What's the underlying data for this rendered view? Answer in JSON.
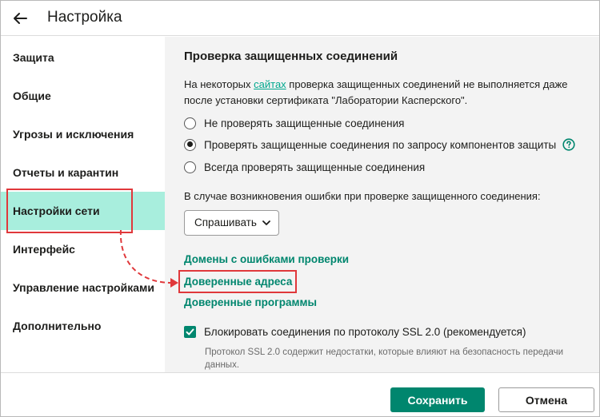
{
  "header": {
    "title": "Настройка"
  },
  "sidebar": {
    "items": [
      {
        "label": "Защита"
      },
      {
        "label": "Общие"
      },
      {
        "label": "Угрозы и исключения"
      },
      {
        "label": "Отчеты и карантин"
      },
      {
        "label": "Настройки сети"
      },
      {
        "label": "Интерфейс"
      },
      {
        "label": "Управление настройками"
      },
      {
        "label": "Дополнительно"
      }
    ],
    "active_index": 4
  },
  "main": {
    "section_title": "Проверка защищенных соединений",
    "desc_before": "На некоторых ",
    "desc_link": "сайтах",
    "desc_after": " проверка защищенных соединений не выполняется даже после установки сертификата \"Лаборатории Касперского\".",
    "radios": [
      {
        "label": "Не проверять защищенные соединения",
        "checked": false
      },
      {
        "label": "Проверять защищенные соединения по запросу компонентов защиты",
        "checked": true
      },
      {
        "label": "Всегда проверять защищенные соединения",
        "checked": false
      }
    ],
    "error_label": "В случае возникновения ошибки при проверке защищенного соединения:",
    "error_dropdown_value": "Спрашивать",
    "links": [
      {
        "label": "Домены с ошибками проверки"
      },
      {
        "label": "Доверенные адреса"
      },
      {
        "label": "Доверенные программы"
      }
    ],
    "ssl_checkbox_label": "Блокировать соединения по протоколу SSL 2.0 (рекомендуется)",
    "ssl_checkbox_checked": true,
    "ssl_note": "Протокол SSL 2.0 содержит недостатки, которые влияют на безопасность передачи данных."
  },
  "footer": {
    "save_label": "Сохранить",
    "cancel_label": "Отмена"
  },
  "colors": {
    "accent": "#00866e",
    "active_bg": "#a8eedd",
    "highlight": "#e0383b",
    "link": "#00a88e"
  }
}
